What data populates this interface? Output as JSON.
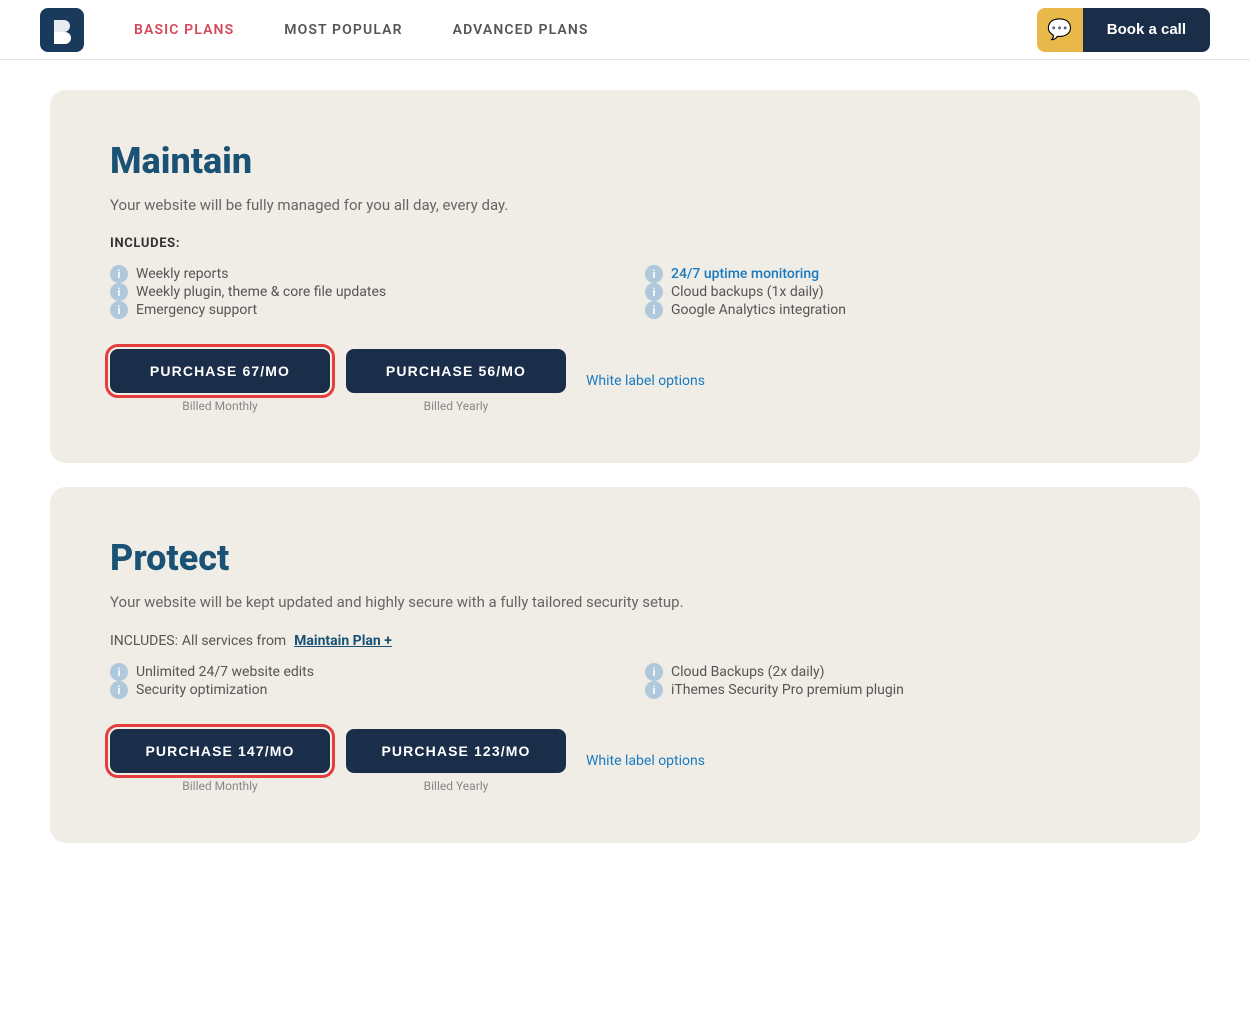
{
  "nav": {
    "logo_letter": "B",
    "links": [
      {
        "id": "basic-plans",
        "label": "Basic Plans",
        "active": true
      },
      {
        "id": "most-popular",
        "label": "Most Popular",
        "active": false
      },
      {
        "id": "advanced-plans",
        "label": "Advanced Plans",
        "active": false
      }
    ],
    "chat_icon": "💬",
    "book_call_label": "Book a call"
  },
  "plans": [
    {
      "id": "maintain",
      "title": "Maintain",
      "description": "Your website will be fully managed for you all day, every day.",
      "includes_label": "INCLUDES:",
      "includes_extra": null,
      "features_left": [
        {
          "text": "Weekly reports",
          "highlight": false
        },
        {
          "text": "Weekly plugin, theme & core file updates",
          "highlight": false
        },
        {
          "text": "Emergency support",
          "highlight": false
        }
      ],
      "features_right": [
        {
          "text": "24/7 uptime monitoring",
          "highlight": true
        },
        {
          "text": "Cloud backups (1x daily)",
          "highlight": false
        },
        {
          "text": "Google Analytics integration",
          "highlight": false
        }
      ],
      "purchase_monthly": {
        "label": "PURCHASE 67/mo",
        "billed": "Billed Monthly",
        "selected": true
      },
      "purchase_yearly": {
        "label": "PURCHASE 56/mo",
        "billed": "Billed Yearly",
        "selected": false
      },
      "white_label": "White label options"
    },
    {
      "id": "protect",
      "title": "Protect",
      "description": "Your website will be kept updated and highly secure with a fully tailored security setup.",
      "includes_label": "INCLUDES:",
      "includes_extra": "All services from",
      "includes_link": "Maintain Plan +",
      "features_left": [
        {
          "text": "Unlimited 24/7 website edits",
          "highlight": false
        },
        {
          "text": "Security optimization",
          "highlight": false
        }
      ],
      "features_right": [
        {
          "text": "Cloud Backups (2x daily)",
          "highlight": false
        },
        {
          "text": "iThemes Security Pro premium plugin",
          "highlight": false
        }
      ],
      "purchase_monthly": {
        "label": "PURCHASE 147/mo",
        "billed": "Billed Monthly",
        "selected": true
      },
      "purchase_yearly": {
        "label": "PURCHASE 123/mo",
        "billed": "Billed Yearly",
        "selected": false
      },
      "white_label": "White label options"
    }
  ]
}
